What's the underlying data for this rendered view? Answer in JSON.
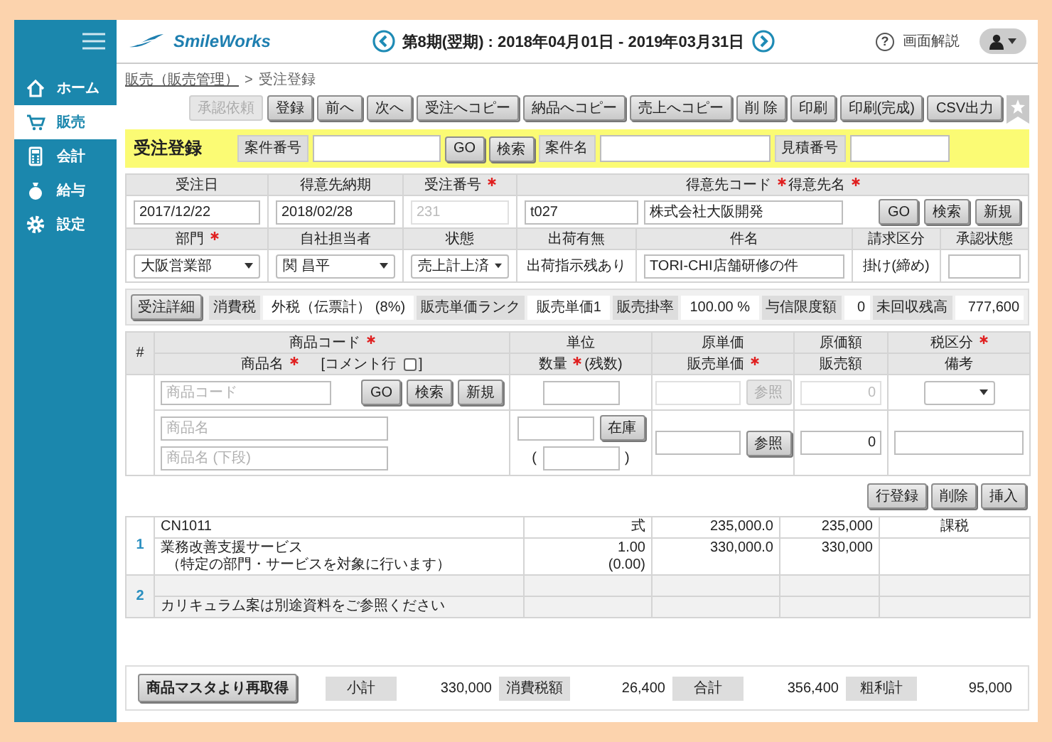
{
  "sidebar": {
    "items": [
      {
        "label": "ホーム",
        "selected": false
      },
      {
        "label": "販売",
        "selected": true
      },
      {
        "label": "会計",
        "selected": false
      },
      {
        "label": "給与",
        "selected": false
      },
      {
        "label": "設定",
        "selected": false
      }
    ]
  },
  "header": {
    "logo": "SmileWorks",
    "period": "第8期(翌期) : 2018年04月01日 - 2019年03月31日",
    "help_mark": "?",
    "help": "画面解説"
  },
  "breadcrumb": {
    "parent": "販売（販売管理）",
    "separator": ">",
    "current": "受注登録"
  },
  "toolbar": [
    {
      "label": "承認依頼",
      "disabled": true
    },
    {
      "label": "登録",
      "disabled": false
    },
    {
      "label": "前へ",
      "disabled": false
    },
    {
      "label": "次へ",
      "disabled": false
    },
    {
      "label": "受注へコピー",
      "disabled": false
    },
    {
      "label": "納品へコピー",
      "disabled": false
    },
    {
      "label": "売上へコピー",
      "disabled": false
    },
    {
      "label": "削 除",
      "disabled": false
    },
    {
      "label": "印刷",
      "disabled": false
    },
    {
      "label": "印刷(完成)",
      "disabled": false
    },
    {
      "label": "CSV出力",
      "disabled": false
    }
  ],
  "title_bar": {
    "title": "受注登録",
    "items": [
      {
        "kind": "label",
        "text": "案件番号"
      },
      {
        "kind": "field",
        "disabled": false
      },
      {
        "kind": "button",
        "label": "GO",
        "disabled": false
      },
      {
        "kind": "button",
        "label": "検索",
        "disabled": false
      },
      {
        "kind": "label",
        "text": "案件名"
      },
      {
        "kind": "field",
        "disabled": false
      },
      {
        "kind": "label",
        "text": "見積番号"
      },
      {
        "kind": "field",
        "disabled": false
      }
    ]
  },
  "order_header": [
    {
      "fields": [
        {
          "labels": [
            {
              "text": "受注日",
              "required": false
            }
          ],
          "controls": [
            {
              "kind": "field",
              "value": "2017/12/22",
              "disabled": false
            }
          ]
        },
        {
          "labels": [
            {
              "text": "得意先納期",
              "required": false
            }
          ],
          "controls": [
            {
              "kind": "field",
              "value": "2018/02/28",
              "disabled": false
            }
          ]
        },
        {
          "labels": [
            {
              "text": "受注番号",
              "required": true
            }
          ],
          "controls": [
            {
              "kind": "field",
              "value": "231",
              "disabled": true
            }
          ]
        },
        {
          "labels": [
            {
              "text": "得意先コード",
              "required": true
            },
            {
              "text": "得意先名",
              "required": true
            }
          ],
          "controls": [
            {
              "kind": "field",
              "value": "t027",
              "disabled": false
            },
            {
              "kind": "field",
              "value": "株式会社大阪開発",
              "disabled": false
            },
            {
              "kind": "button",
              "label": "GO",
              "disabled": false
            },
            {
              "kind": "button",
              "label": "検索",
              "disabled": false
            },
            {
              "kind": "button",
              "label": "新規",
              "disabled": false
            }
          ]
        }
      ]
    },
    {
      "fields": [
        {
          "labels": [
            {
              "text": "部門",
              "required": true
            }
          ],
          "controls": [
            {
              "kind": "select",
              "value": "大阪営業部"
            }
          ]
        },
        {
          "labels": [
            {
              "text": "自社担当者",
              "required": false
            }
          ],
          "controls": [
            {
              "kind": "select",
              "value": "関 昌平"
            }
          ]
        },
        {
          "labels": [
            {
              "text": "状態",
              "required": false
            }
          ],
          "controls": [
            {
              "kind": "select",
              "value": "売上計上済"
            }
          ]
        },
        {
          "labels": [
            {
              "text": "出荷有無",
              "required": false
            }
          ],
          "controls": [
            {
              "kind": "text",
              "value": "出荷指示残あり"
            }
          ]
        },
        {
          "labels": [
            {
              "text": "件名",
              "required": false
            }
          ],
          "controls": [
            {
              "kind": "field",
              "value": "TORI-CHI店舗研修の件",
              "disabled": false
            }
          ]
        },
        {
          "labels": [
            {
              "text": "請求区分",
              "required": false
            }
          ],
          "controls": [
            {
              "kind": "text",
              "value": "掛け(締め)"
            }
          ]
        },
        {
          "labels": [
            {
              "text": "承認状態",
              "required": false
            }
          ],
          "controls": [
            {
              "kind": "field",
              "disabled": false
            }
          ]
        }
      ]
    }
  ],
  "summary": [
    {
      "kind": "button",
      "label": "受注詳細"
    },
    {
      "kind": "label",
      "text": "消費税"
    },
    {
      "kind": "value",
      "text": "外税（伝票計） (8%)"
    },
    {
      "kind": "label",
      "text": "販売単価ランク"
    },
    {
      "kind": "value",
      "text": "販売単価1"
    },
    {
      "kind": "label",
      "text": "販売掛率"
    },
    {
      "kind": "value",
      "text": "100.00 %"
    },
    {
      "kind": "label",
      "text": "与信限度額"
    },
    {
      "kind": "amount",
      "text": "0"
    },
    {
      "kind": "label",
      "text": "未回収残高"
    },
    {
      "kind": "amount",
      "text": "777,600"
    }
  ],
  "entry_table": {
    "number_header": "#",
    "columns": [
      {
        "top": {
          "text": "商品コード",
          "required": true
        },
        "bottom": {
          "text": "商品名",
          "required": true
        },
        "comment_toggle": {
          "label": "[コメント行",
          "checked": false,
          "close": "]"
        }
      },
      {
        "top": {
          "text": "単位",
          "required": false
        },
        "bottom": {
          "text": "数量",
          "required": true,
          "suffix": "(残数)"
        }
      },
      {
        "top": {
          "text": "原単価",
          "required": false
        },
        "bottom": {
          "text": "販売単価",
          "required": true
        }
      },
      {
        "top": {
          "text": "原価額",
          "required": false
        },
        "bottom": {
          "text": "販売額",
          "required": false
        }
      },
      {
        "top": {
          "text": "税区分",
          "required": true
        },
        "bottom": {
          "text": "備考",
          "required": false
        }
      }
    ],
    "rows": [
      {
        "cells": [
          [
            [
              {
                "kind": "field",
                "placeholder": "商品コード",
                "disabled": false
              },
              {
                "kind": "button",
                "label": "GO",
                "disabled": false
              },
              {
                "kind": "button",
                "label": "検索",
                "disabled": false
              },
              {
                "kind": "button",
                "label": "新規",
                "disabled": false
              }
            ]
          ],
          [
            [
              {
                "kind": "field",
                "disabled": false
              }
            ]
          ],
          [
            [
              {
                "kind": "field",
                "disabled": true
              },
              {
                "kind": "button",
                "label": "参照",
                "disabled": true
              }
            ]
          ],
          [
            [
              {
                "kind": "amount_field",
                "value": "0",
                "disabled": true
              }
            ]
          ],
          [
            [
              {
                "kind": "select"
              }
            ]
          ]
        ]
      },
      {
        "cells": [
          [
            [
              {
                "kind": "field",
                "placeholder": "商品名",
                "disabled": false
              }
            ],
            [
              {
                "kind": "field",
                "placeholder": "商品名 (下段)",
                "disabled": false
              }
            ]
          ],
          [
            [
              {
                "kind": "field",
                "disabled": false
              },
              {
                "kind": "button",
                "label": "在庫",
                "disabled": false
              }
            ],
            [
              {
                "kind": "text",
                "value": "("
              },
              {
                "kind": "field",
                "disabled": false
              },
              {
                "kind": "text",
                "value": ")"
              }
            ]
          ],
          [
            [
              {
                "kind": "field",
                "disabled": false
              },
              {
                "kind": "button",
                "label": "参照",
                "disabled": false
              }
            ]
          ],
          [
            [
              {
                "kind": "amount_field",
                "value": "0",
                "disabled": false
              }
            ]
          ],
          [
            [
              {
                "kind": "field",
                "disabled": false
              }
            ]
          ]
        ]
      }
    ]
  },
  "row_actions": [
    {
      "label": "行登録"
    },
    {
      "label": "削除"
    },
    {
      "label": "挿入"
    }
  ],
  "details": [
    {
      "number": "1",
      "comment": false,
      "code_line": {
        "product": "CN1011",
        "unit": "式",
        "price": "235,000.0",
        "amount": "235,000",
        "tax": "課税"
      },
      "main_line": {
        "product": "業務改善支援サービス",
        "product_note": "（特定の部門・サービスを対象に行います）",
        "unit": "1.00",
        "unit_note": "(0.00)",
        "price": "330,000.0",
        "amount": "330,000"
      }
    },
    {
      "number": "2",
      "comment": true,
      "main_line": {
        "product": "カリキュラム案は別途資料をご参照ください"
      }
    }
  ],
  "totals": {
    "button": "商品マスタより再取得",
    "items": [
      {
        "label": "小計",
        "value": "330,000"
      },
      {
        "label": "消費税額",
        "value": "26,400"
      },
      {
        "label": "合計",
        "value": "356,400"
      },
      {
        "label": "粗利計",
        "value": "95,000"
      }
    ]
  }
}
